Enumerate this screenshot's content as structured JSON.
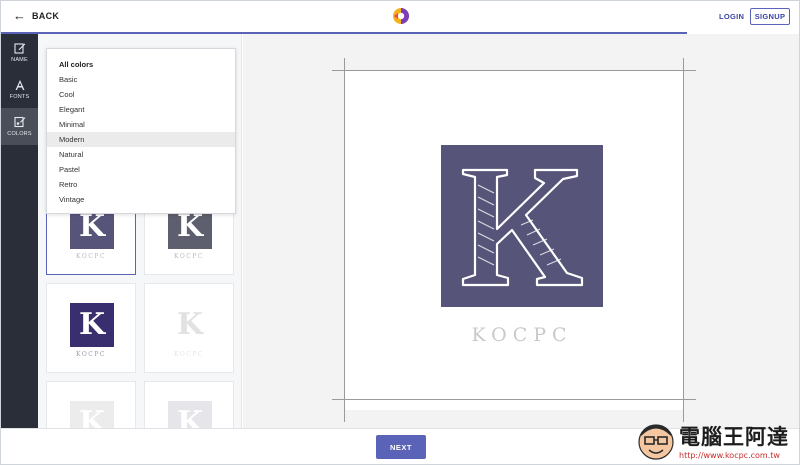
{
  "header": {
    "back_label": "BACK",
    "login_label": "LOGIN",
    "signup_label": "SIGNUP"
  },
  "nav": {
    "items": [
      {
        "label": "NAME",
        "icon": "edit-icon"
      },
      {
        "label": "FONTS",
        "icon": "font-icon"
      },
      {
        "label": "COLORS",
        "icon": "palette-icon"
      }
    ],
    "active": "COLORS"
  },
  "dropdown": {
    "items": [
      "All colors",
      "Basic",
      "Cool",
      "Elegant",
      "Minimal",
      "Modern",
      "Natural",
      "Pastel",
      "Retro",
      "Vintage"
    ],
    "highlighted": "Modern"
  },
  "thumbnails": {
    "items": [
      {
        "letter": "K",
        "caption": "KOCPC",
        "bg": "#575479",
        "fg": "#ffffff",
        "cap_color": "#b9b9c2"
      },
      {
        "letter": "K",
        "caption": "KOCPC",
        "bg": "#5d5f6e",
        "fg": "#ffffff",
        "cap_color": "#b9b9c2"
      },
      {
        "letter": "K",
        "caption": "KOCPC",
        "bg": "#3a2f6e",
        "fg": "#ffffff",
        "cap_color": "#9b96ad"
      },
      {
        "letter": "K",
        "caption": "KOCPC",
        "bg": "#ffffff",
        "fg": "#e2e2e2",
        "cap_color": "#e4e4e4"
      },
      {
        "letter": "K",
        "caption": "",
        "bg": "#ececec",
        "fg": "#ffffff",
        "cap_color": "#e4e4e4"
      },
      {
        "letter": "K",
        "caption": "",
        "bg": "#e6e6ea",
        "fg": "#ffffff",
        "cap_color": "#e4e4e4"
      }
    ]
  },
  "preview": {
    "letter": "K",
    "caption": "KOCPC",
    "bg_color": "#575479"
  },
  "footer": {
    "next_label": "NEXT"
  },
  "watermark": {
    "title": "電腦王阿達",
    "url": "http://www.kocpc.com.tw"
  },
  "colors": {
    "accent": "#5b63b8",
    "sidebar": "#2a2e38"
  }
}
